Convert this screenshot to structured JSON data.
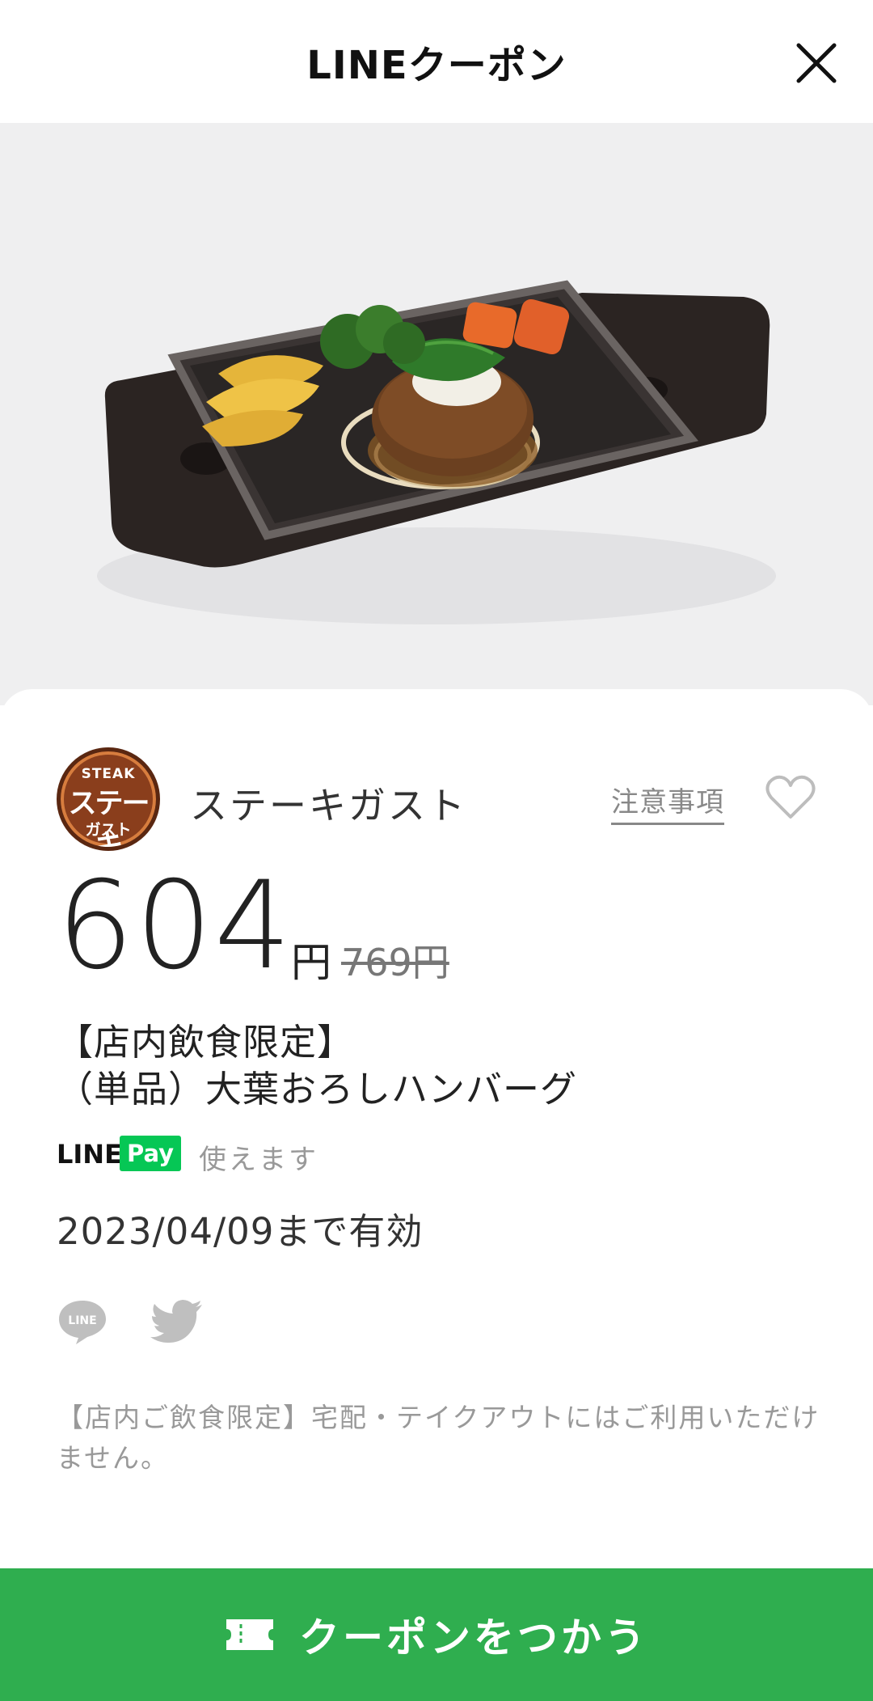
{
  "header": {
    "title": "LINEクーポン"
  },
  "icons": {
    "close": "close-icon",
    "heart": "heart-icon",
    "line_share": "line-icon",
    "twitter_share": "twitter-icon",
    "ticket": "ticket-icon"
  },
  "colors": {
    "cta_green": "#2fae4f",
    "line_pay_green": "#06c755",
    "brand_brown": "#8a3e1c"
  },
  "shop": {
    "logo_top": "STEAK",
    "logo_mid": "ステーキ",
    "logo_bot": "ガスト",
    "name": "ステーキガスト",
    "notes_label": "注意事項"
  },
  "price": {
    "value": "604",
    "unit": "円",
    "original": "769円"
  },
  "title": {
    "line1": "【店内飲食限定】",
    "line2": "（単品）大葉おろしハンバーグ"
  },
  "payment": {
    "brand_line": "LINE",
    "brand_pay": "Pay",
    "status": "使えます"
  },
  "validity": "2023/04/09まで有効",
  "notice": "【店内ご飲食限定】宅配・テイクアウトにはご利用いただけません。",
  "cta": {
    "label": "クーポンをつかう"
  }
}
